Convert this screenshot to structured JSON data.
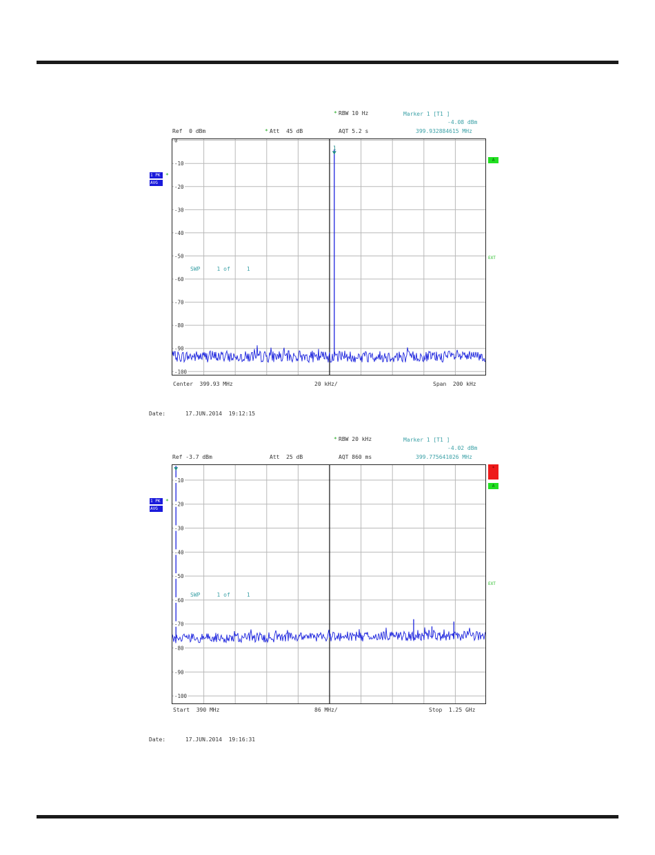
{
  "chart_data": [
    {
      "type": "line",
      "header": {
        "rbw": "RBW 10 Hz",
        "att": "Att  45 dB",
        "ref": "Ref  0 dBm",
        "aqt": "AQT 5.2 s",
        "marker_title": "Marker 1 [T1 ]",
        "marker_level": "-4.08 dBm",
        "marker_freq": "399.932884615 MHz",
        "star": "*"
      },
      "trace_tags": [
        "1 PK",
        "AVG"
      ],
      "side_tags": [
        "A"
      ],
      "ext_label": "EXT",
      "sweep_label": "SWP     1 of     1",
      "marker_num": "1",
      "ytick_labels": [
        "0",
        "-10",
        "-20",
        "-30",
        "-40",
        "-50",
        "-60",
        "-70",
        "-80",
        "-90",
        "-100"
      ],
      "ytick_values": [
        0,
        -10,
        -20,
        -30,
        -40,
        -50,
        -60,
        -70,
        -80,
        -90,
        -100
      ],
      "ylim": [
        -102,
        0.5
      ],
      "x_axis": {
        "left": "Center  399.93 MHz",
        "mid": "20 kHz/",
        "right": "Span  200 kHz"
      },
      "x_unit": "kHz offset from center",
      "xlim": [
        -100,
        100
      ],
      "marker_x": 3,
      "noise_floor": -93.5,
      "noise_amp": 2.5,
      "peaks": [
        {
          "x": 3,
          "y": -4.08
        }
      ],
      "vertical_line_x": 0,
      "date": "Date:      17.JUN.2014  19:12:15"
    },
    {
      "type": "line",
      "header": {
        "rbw": "RBW 20 kHz",
        "att": "Att  25 dB",
        "ref": "Ref -3.7 dBm",
        "aqt": "AQT 860 ms",
        "marker_title": "Marker 1 [T1 ]",
        "marker_level": "-4.02 dBm",
        "marker_freq": "399.775641026 MHz",
        "star": "*"
      },
      "trace_tags": [
        "1 PK",
        "AVG"
      ],
      "side_tags": [
        "*",
        "A"
      ],
      "ext_label": "EXT",
      "sweep_label": "SWP     1 of     1",
      "marker_num": "1",
      "ytick_labels": [
        "-10",
        "-20",
        "-30",
        "-40",
        "-50",
        "-60",
        "-70",
        "-80",
        "-90",
        "-100"
      ],
      "ytick_values": [
        -10,
        -20,
        -30,
        -40,
        -50,
        -60,
        -70,
        -80,
        -90,
        -100
      ],
      "ylim": [
        -103.7,
        -3.7
      ],
      "x_axis": {
        "left": "Start  390 MHz",
        "mid": "86 MHz/",
        "right": "Stop  1.25 GHz"
      },
      "x_unit": "MHz",
      "xlim": [
        390,
        1250
      ],
      "marker_x": 399.78,
      "noise_floor": -76,
      "noise_amp": 2,
      "peaks": [
        {
          "x": 399.78,
          "y": -4.02
        },
        {
          "x": 1050,
          "y": -68
        },
        {
          "x": 1100,
          "y": -71
        },
        {
          "x": 1160,
          "y": -69
        }
      ],
      "vertical_line_x": 820,
      "date": "Date:      17.JUN.2014  19:16:31"
    }
  ]
}
